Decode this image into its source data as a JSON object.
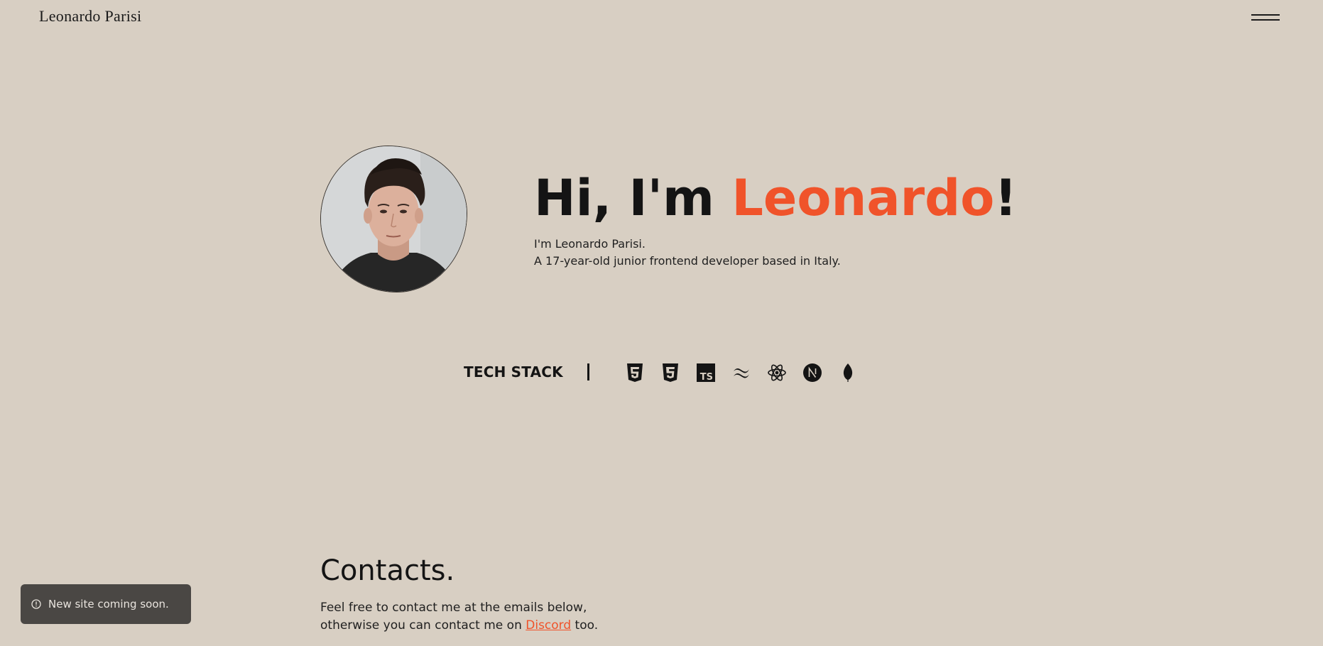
{
  "header": {
    "logo": "Leonardo Parisi",
    "menu_icon": "hamburger-menu-icon"
  },
  "hero": {
    "greeting": "Hi, I'm ",
    "name": "Leonardo",
    "exclamation": "!",
    "line1": "I'm Leonardo Parisi.",
    "line2": "A 17-year-old junior frontend developer based in Italy.",
    "accent_color": "#f0532a"
  },
  "tech_stack": {
    "label": "TECH STACK",
    "divider": "|",
    "icons": [
      "html5-icon",
      "css3-icon",
      "typescript-icon",
      "tailwindcss-icon",
      "react-icon",
      "nextjs-icon",
      "mongodb-icon"
    ]
  },
  "contacts": {
    "title": "Contacts.",
    "text_before": "Feel free to contact me at the emails below, otherwise you can contact me on ",
    "link": "Discord",
    "text_after": " too."
  },
  "toast": {
    "icon": "info-circle-icon",
    "message": "New site coming soon."
  },
  "colors": {
    "background": "#d8cfc3",
    "text": "#141414",
    "accent": "#f0532a",
    "toast_bg": "#4a4744"
  }
}
